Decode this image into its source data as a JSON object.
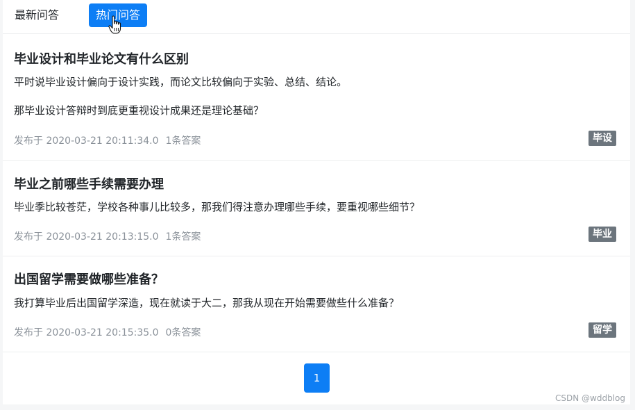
{
  "tabs": {
    "latest": "最新问答",
    "hot": "热门问答"
  },
  "questions": [
    {
      "title": "毕业设计和毕业论文有什么区别",
      "body_lines": [
        "平时说毕业设计偏向于设计实践，而论文比较偏向于实验、总结、结论。",
        " 那毕业设计答辩时到底更重视设计成果还是理论基础？"
      ],
      "published": "发布于 2020-03-21 20:11:34.0",
      "answers": "1条答案",
      "tag": "毕设"
    },
    {
      "title": "毕业之前哪些手续需要办理",
      "body_lines": [
        "毕业季比较苍茫，学校各种事儿比较多，那我们得注意办理哪些手续，要重视哪些细节？"
      ],
      "published": "发布于 2020-03-21 20:13:15.0",
      "answers": "1条答案",
      "tag": "毕业"
    },
    {
      "title": "出国留学需要做哪些准备？",
      "body_lines": [
        "我打算毕业后出国留学深造，现在就读于大二，那我从现在开始需要做些什么准备？"
      ],
      "published": "发布于 2020-03-21 20:15:35.0",
      "answers": "0条答案",
      "tag": "留学"
    }
  ],
  "pagination": {
    "current_page": "1"
  },
  "watermark": "CSDN @wddblog",
  "colors": {
    "accent": "#0d7ef5",
    "tag_bg": "#6c757d",
    "meta_text": "#8a9199"
  }
}
